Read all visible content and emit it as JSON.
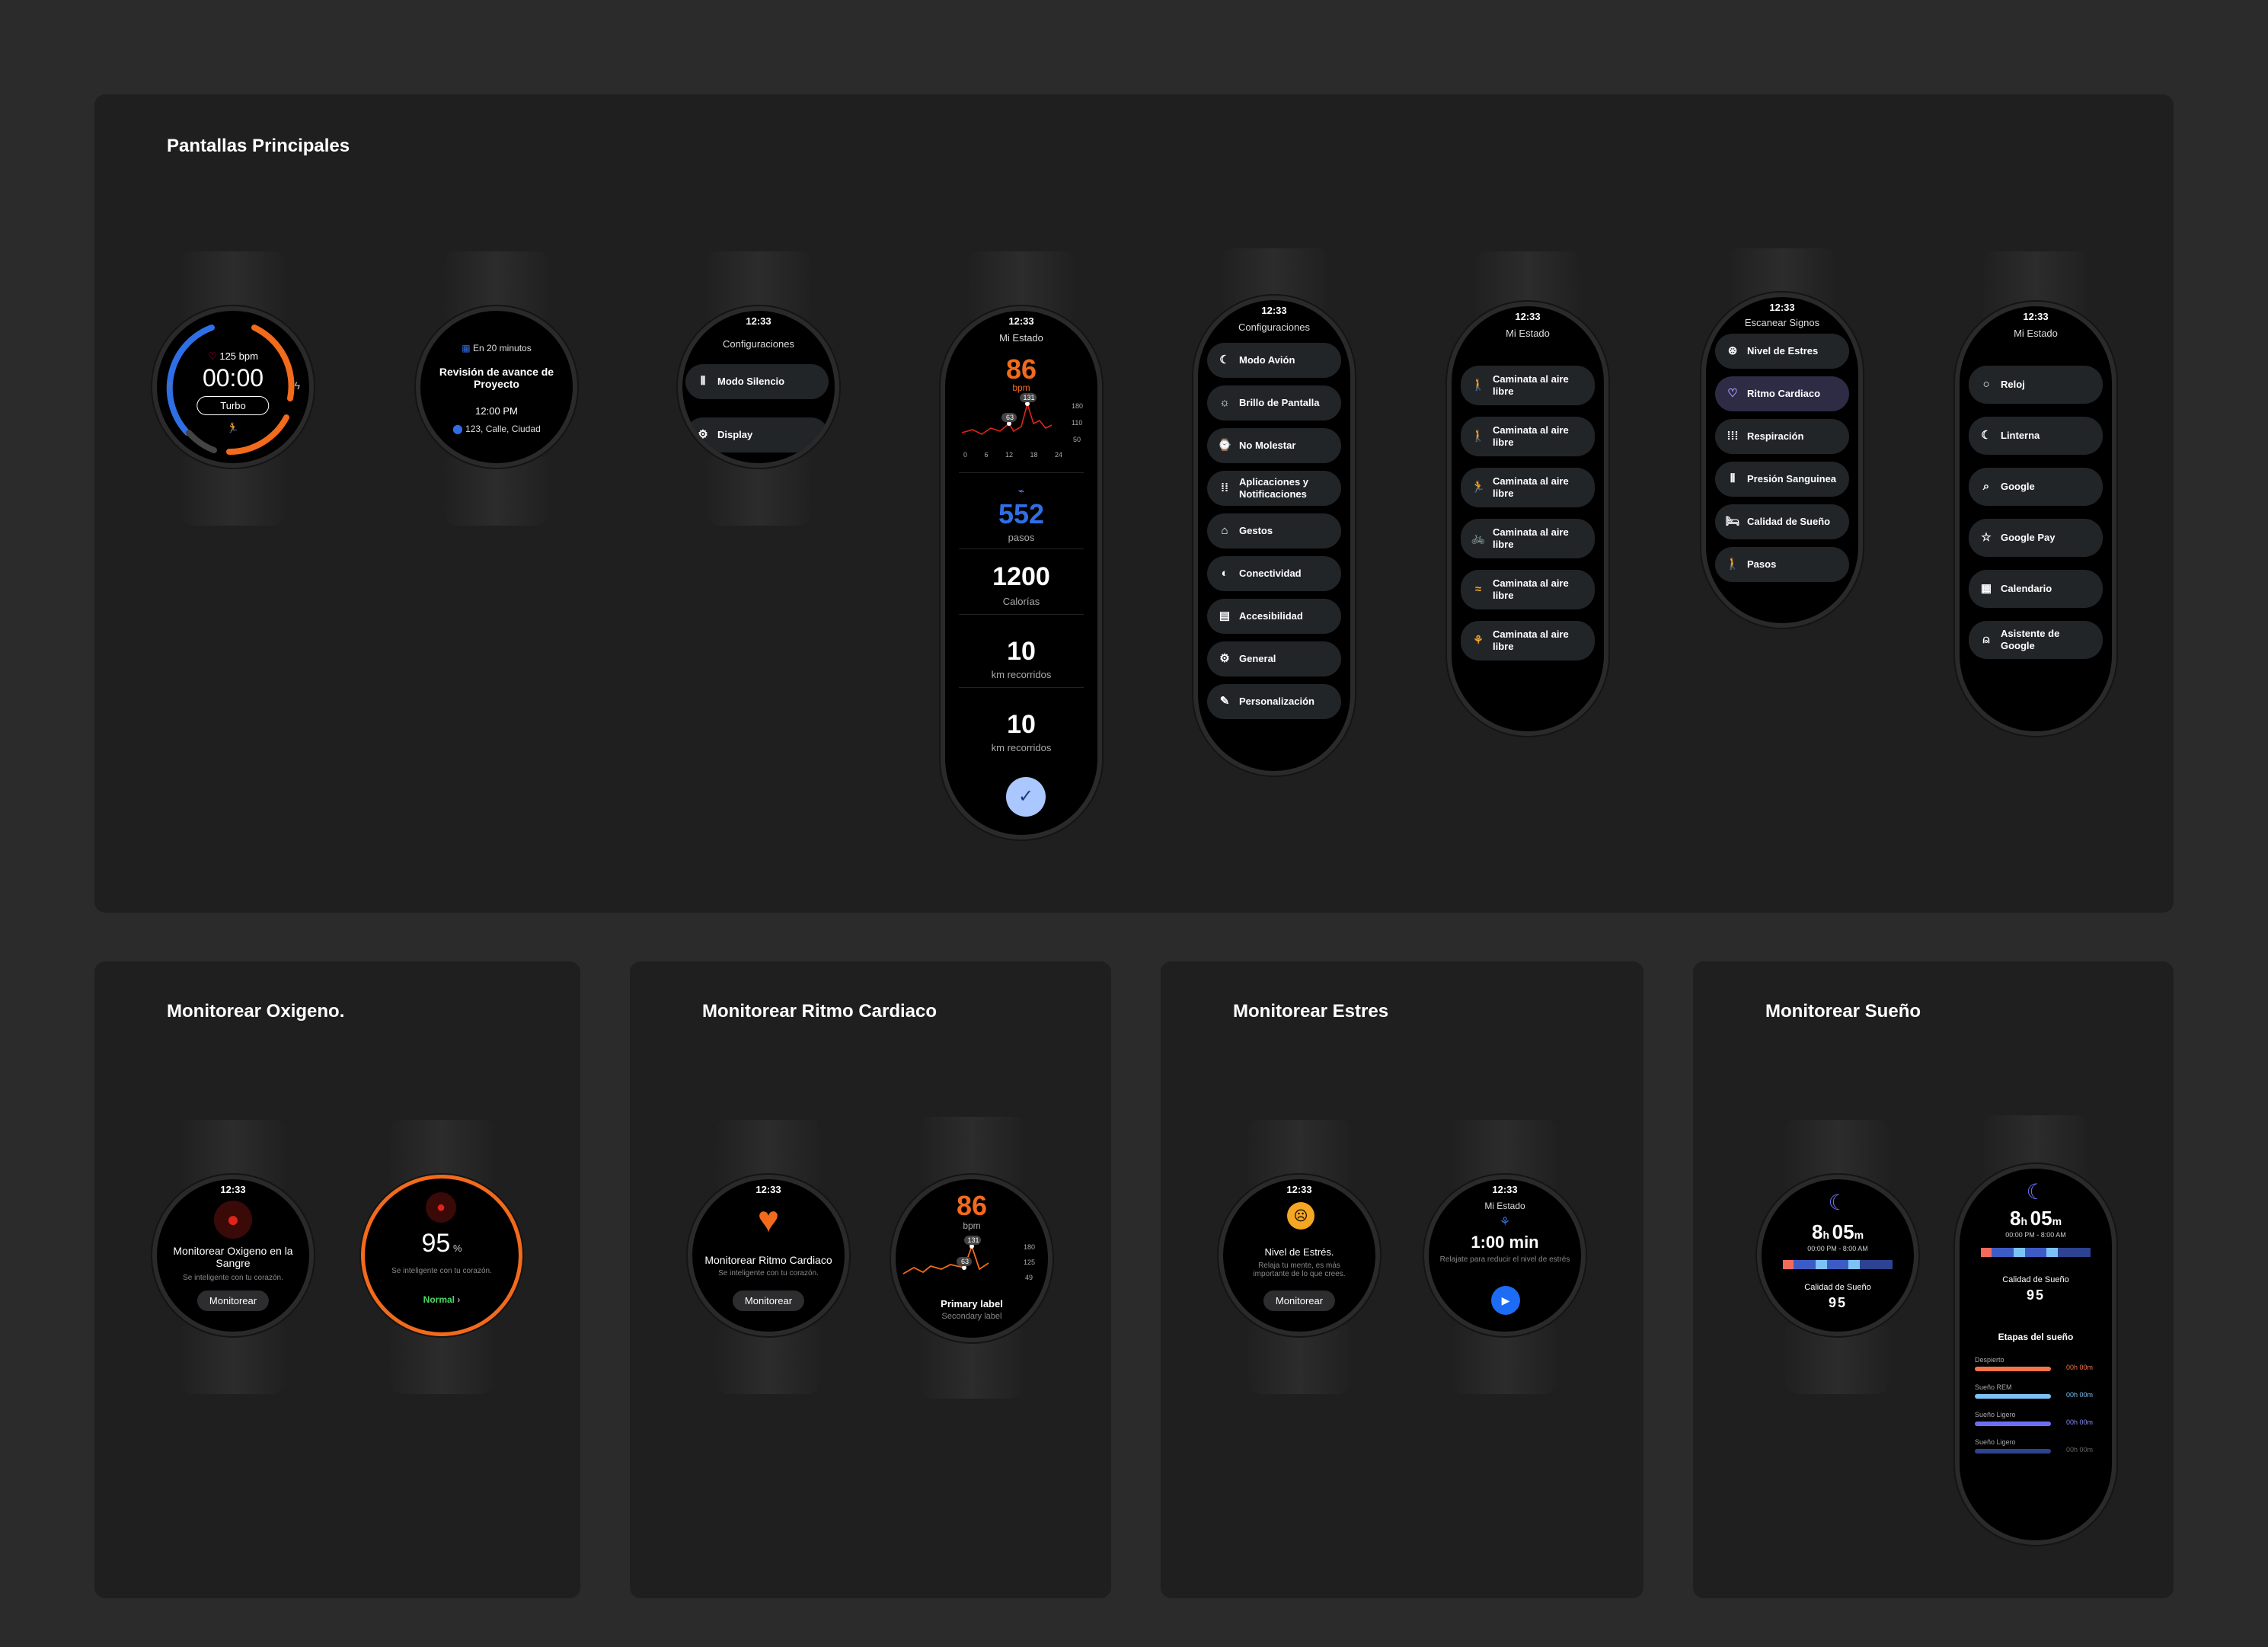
{
  "sections": {
    "main_title": "Pantallas Principales",
    "oxygen_title": "Monitorear Oxigeno.",
    "heart_title": "Monitorear Ritmo Cardiaco",
    "stress_title": "Monitorear Estres",
    "sleep_title": "Monitorear Sueño"
  },
  "w1": {
    "bpm": "125 bpm",
    "timer": "00:00",
    "button": "Turbo"
  },
  "w2": {
    "when": "En 20 minutos",
    "event": "Revisión de avance de Proyecto",
    "hour": "12:00 PM",
    "place": "123, Calle, Ciudad"
  },
  "w3": {
    "time": "12:33",
    "title": "Configuraciones",
    "items": [
      "Modo Silencio",
      "Display"
    ]
  },
  "w4": {
    "time": "12:33",
    "title": "Mi Estado",
    "bpm_value": "86",
    "bpm_unit": "bpm",
    "steps": "552",
    "steps_label": "pasos",
    "calories": "1200",
    "calories_label": "Calorías",
    "km1": "10",
    "km1_label": "km recorridos",
    "km2": "10",
    "km2_label": "km recorridos",
    "chart": {
      "y_ticks": [
        "180",
        "110",
        "50"
      ],
      "x_ticks": [
        "0",
        "6",
        "12",
        "18",
        "24"
      ],
      "badge_low": "63",
      "badge_high": "131"
    }
  },
  "w5": {
    "time": "12:33",
    "title": "Configuraciones",
    "items": [
      "Modo Avión",
      "Brillo de Pantalla",
      "No Molestar",
      "Aplicaciones y Notificaciones",
      "Gestos",
      "Conectividad",
      "Accesibilidad",
      "General",
      "Personalización"
    ]
  },
  "w6": {
    "time": "12:33",
    "title": "Mi Estado",
    "items": [
      "Caminata al aire libre",
      "Caminata al aire libre",
      "Caminata al aire libre",
      "Caminata al aire libre",
      "Caminata al aire libre",
      "Caminata al aire libre"
    ]
  },
  "w7": {
    "time": "12:33",
    "title": "Escanear Signos",
    "items": [
      "Nivel de Estres",
      "Ritmo Cardiaco",
      "Respiración",
      "Presión Sanguinea",
      "Calidad de Sueño",
      "Pasos"
    ]
  },
  "w8": {
    "time": "12:33",
    "title": "Mi Estado",
    "items": [
      "Reloj",
      "Linterna",
      "Google",
      "Google Pay",
      "Calendario",
      "Asistente de Google"
    ]
  },
  "ox1": {
    "time": "12:33",
    "title": "Monitorear Oxigeno en la Sangre",
    "sub": "Se inteligente con tu corazón.",
    "button": "Monitorear"
  },
  "ox2": {
    "value": "95",
    "unit": "%",
    "sub": "Se inteligente con tu corazón.",
    "status": "Normal"
  },
  "hr1": {
    "time": "12:33",
    "title": "Monitorear Ritmo Cardiaco",
    "sub": "Se inteligente con tu corazón.",
    "button": "Monitorear"
  },
  "hr2": {
    "value": "86",
    "unit": "bpm",
    "badge_low": "63",
    "badge_high": "131",
    "y_ticks": [
      "180",
      "125",
      "49"
    ],
    "primary": "Primary label",
    "secondary": "Secondary label"
  },
  "st1": {
    "time": "12:33",
    "title": "Nivel de Estrés.",
    "sub": "Relaja tu mente, es más importante  de lo que crees.",
    "button": "Monitorear"
  },
  "st2": {
    "time": "12:33",
    "title": "Mi Estado",
    "duration": "1:00 min",
    "sub": "Relajate para reducir el nivel de estrés"
  },
  "sl1": {
    "hours": "8",
    "h": "h",
    "mins": "05",
    "m": "m",
    "range": "00:00 PM  -  8:00 AM",
    "quality_label": "Calidad de Sueño",
    "quality": "95"
  },
  "sl2": {
    "hours": "8",
    "h": "h",
    "mins": "05",
    "m": "m",
    "range": "00:00 PM  -  8:00 AM",
    "quality_label": "Calidad de Sueño",
    "quality": "95",
    "stages_title": "Etapas del sueño",
    "stages": [
      {
        "name": "Despierto",
        "value": "00h 00m"
      },
      {
        "name": "Sueño REM",
        "value": "00h 00m"
      },
      {
        "name": "Sueño Ligero",
        "value": "00h 00m"
      },
      {
        "name": "Sueño Ligero",
        "value": "00h 00m"
      }
    ]
  },
  "colors": {
    "orange": "#f26a1b",
    "blue": "#2f6fe6",
    "accent_purple": "#6c6ff5",
    "red": "#e0241b",
    "green": "#4cd964",
    "stress_yellow": "#f5a623"
  }
}
